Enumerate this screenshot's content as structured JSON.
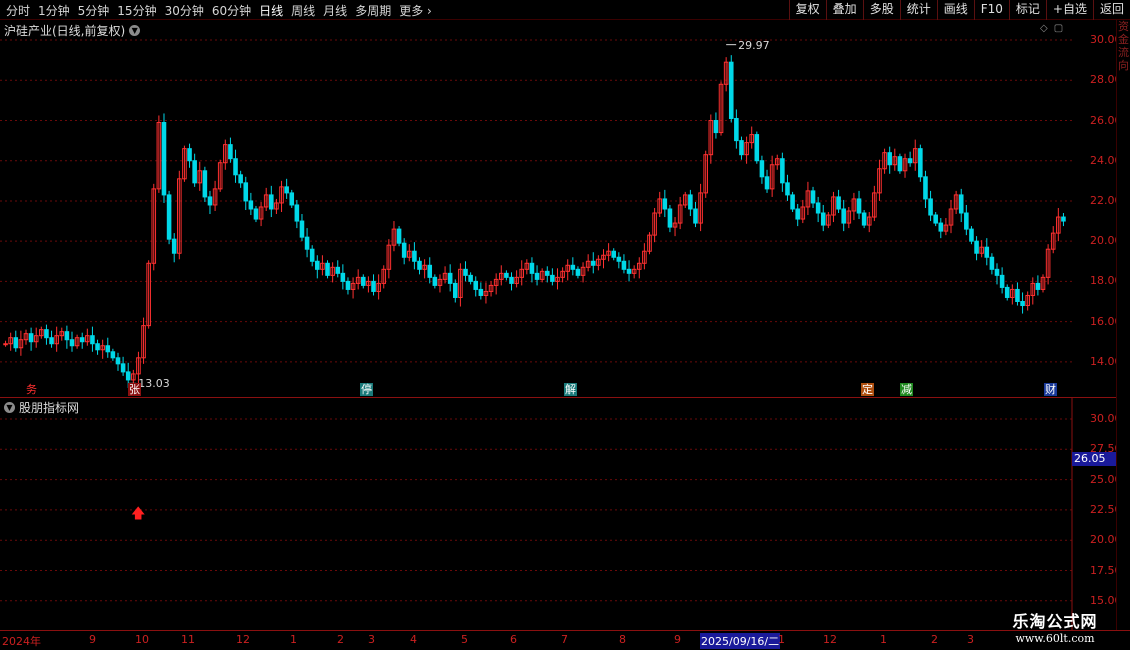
{
  "toolbar": {
    "periods": [
      "分时",
      "1分钟",
      "5分钟",
      "15分钟",
      "30分钟",
      "60分钟",
      "日线",
      "周线",
      "月线",
      "多周期",
      "更多"
    ],
    "active_period": "日线",
    "actions": [
      "复权",
      "叠加",
      "多股",
      "统计",
      "画线",
      "F10",
      "标记",
      "+自选",
      "返回"
    ]
  },
  "main_chart": {
    "title": "沪硅产业(日线,前复权)",
    "high_label": "29.97",
    "low_label": "13.03",
    "y_ticks": [
      "30.00",
      "28.00",
      "26.00",
      "24.00",
      "22.00",
      "20.00",
      "18.00",
      "16.00",
      "14.00"
    ],
    "event_markers": [
      {
        "text": "务",
        "color": "#ff3030",
        "bg": "#000000"
      },
      {
        "text": "张",
        "color": "#ffffff",
        "bg": "#8c1010"
      },
      {
        "text": "停",
        "color": "#ffffff",
        "bg": "#1a7a7a"
      },
      {
        "text": "解",
        "color": "#ffffff",
        "bg": "#1a7a7a"
      },
      {
        "text": "定",
        "color": "#ffffff",
        "bg": "#b05010"
      },
      {
        "text": "减",
        "color": "#ffffff",
        "bg": "#208a20"
      },
      {
        "text": "财",
        "color": "#ffffff",
        "bg": "#1a3a9a"
      }
    ]
  },
  "sub_chart": {
    "title": "股朋指标网",
    "y_ticks": [
      "30.00",
      "27.50",
      "25.00",
      "22.50",
      "20.00",
      "17.50",
      "15.00"
    ],
    "current_value": "26.05",
    "signal_marker": "up-arrow"
  },
  "date_axis": {
    "labels": [
      "2024年",
      "9",
      "10",
      "11",
      "12",
      "1",
      "2",
      "3",
      "4",
      "5",
      "6",
      "7",
      "8",
      "9",
      "2025/09/16/二",
      "1",
      "12",
      "1",
      "2",
      "3"
    ]
  },
  "right_strip": {
    "text": [
      "资",
      "金",
      "流",
      "向"
    ]
  },
  "watermark": {
    "title": "乐淘公式网",
    "url": "www.60lt.com"
  },
  "colors": {
    "up": "#ff3030",
    "down": "#00d8e8",
    "axis": "#cc2020",
    "grid": "#6a0a0a"
  },
  "chart_data": {
    "type": "candlestick",
    "title": "沪硅产业(日线,前复权)",
    "ylim": [
      12.5,
      30.5
    ],
    "closes": [
      14.9,
      15.2,
      14.7,
      15.1,
      15.4,
      15.0,
      15.3,
      15.6,
      15.2,
      14.9,
      15.3,
      15.5,
      15.1,
      14.8,
      15.2,
      15.0,
      15.3,
      14.9,
      14.6,
      14.8,
      14.5,
      14.2,
      13.9,
      13.5,
      13.1,
      13.4,
      14.2,
      15.8,
      18.9,
      22.6,
      25.9,
      22.3,
      20.1,
      19.4,
      23.1,
      24.6,
      24.0,
      22.9,
      23.5,
      22.2,
      21.8,
      22.6,
      23.9,
      24.8,
      24.1,
      23.3,
      22.9,
      22.0,
      21.6,
      21.1,
      21.7,
      22.3,
      21.6,
      21.9,
      22.7,
      22.4,
      21.8,
      21.0,
      20.2,
      19.6,
      19.0,
      18.6,
      18.9,
      18.3,
      18.7,
      18.4,
      18.0,
      17.6,
      17.9,
      18.2,
      17.8,
      18.0,
      17.5,
      17.9,
      18.6,
      19.8,
      20.6,
      19.9,
      19.2,
      19.5,
      19.0,
      18.6,
      18.8,
      18.2,
      17.8,
      18.1,
      18.4,
      17.9,
      17.2,
      18.6,
      18.3,
      18.0,
      17.6,
      17.3,
      17.5,
      17.8,
      18.1,
      18.4,
      18.2,
      17.9,
      18.2,
      18.6,
      18.9,
      18.4,
      18.1,
      18.5,
      18.3,
      18.0,
      18.2,
      18.5,
      18.8,
      18.6,
      18.3,
      18.7,
      19.0,
      18.8,
      19.1,
      19.3,
      19.5,
      19.2,
      19.0,
      18.6,
      18.4,
      18.6,
      18.9,
      19.5,
      20.3,
      21.4,
      22.1,
      21.6,
      20.7,
      20.9,
      21.8,
      22.3,
      21.6,
      20.9,
      22.4,
      24.3,
      26.0,
      25.4,
      27.8,
      28.9,
      26.1,
      25.0,
      24.3,
      24.9,
      25.3,
      24.0,
      23.2,
      22.6,
      23.8,
      24.1,
      22.9,
      22.3,
      21.6,
      21.1,
      21.7,
      22.5,
      21.9,
      21.4,
      20.8,
      21.3,
      22.2,
      21.6,
      20.9,
      21.5,
      22.1,
      21.4,
      20.8,
      21.2,
      22.4,
      23.6,
      24.4,
      23.8,
      24.2,
      23.5,
      24.1,
      23.9,
      24.6,
      23.2,
      22.1,
      21.3,
      20.9,
      20.5,
      20.8,
      21.6,
      22.3,
      21.4,
      20.6,
      20.0,
      19.4,
      19.7,
      19.2,
      18.6,
      18.3,
      17.7,
      17.2,
      17.6,
      17.0,
      16.8,
      17.3,
      17.9,
      17.6,
      18.2,
      19.6,
      20.4,
      21.2,
      21.0
    ]
  }
}
